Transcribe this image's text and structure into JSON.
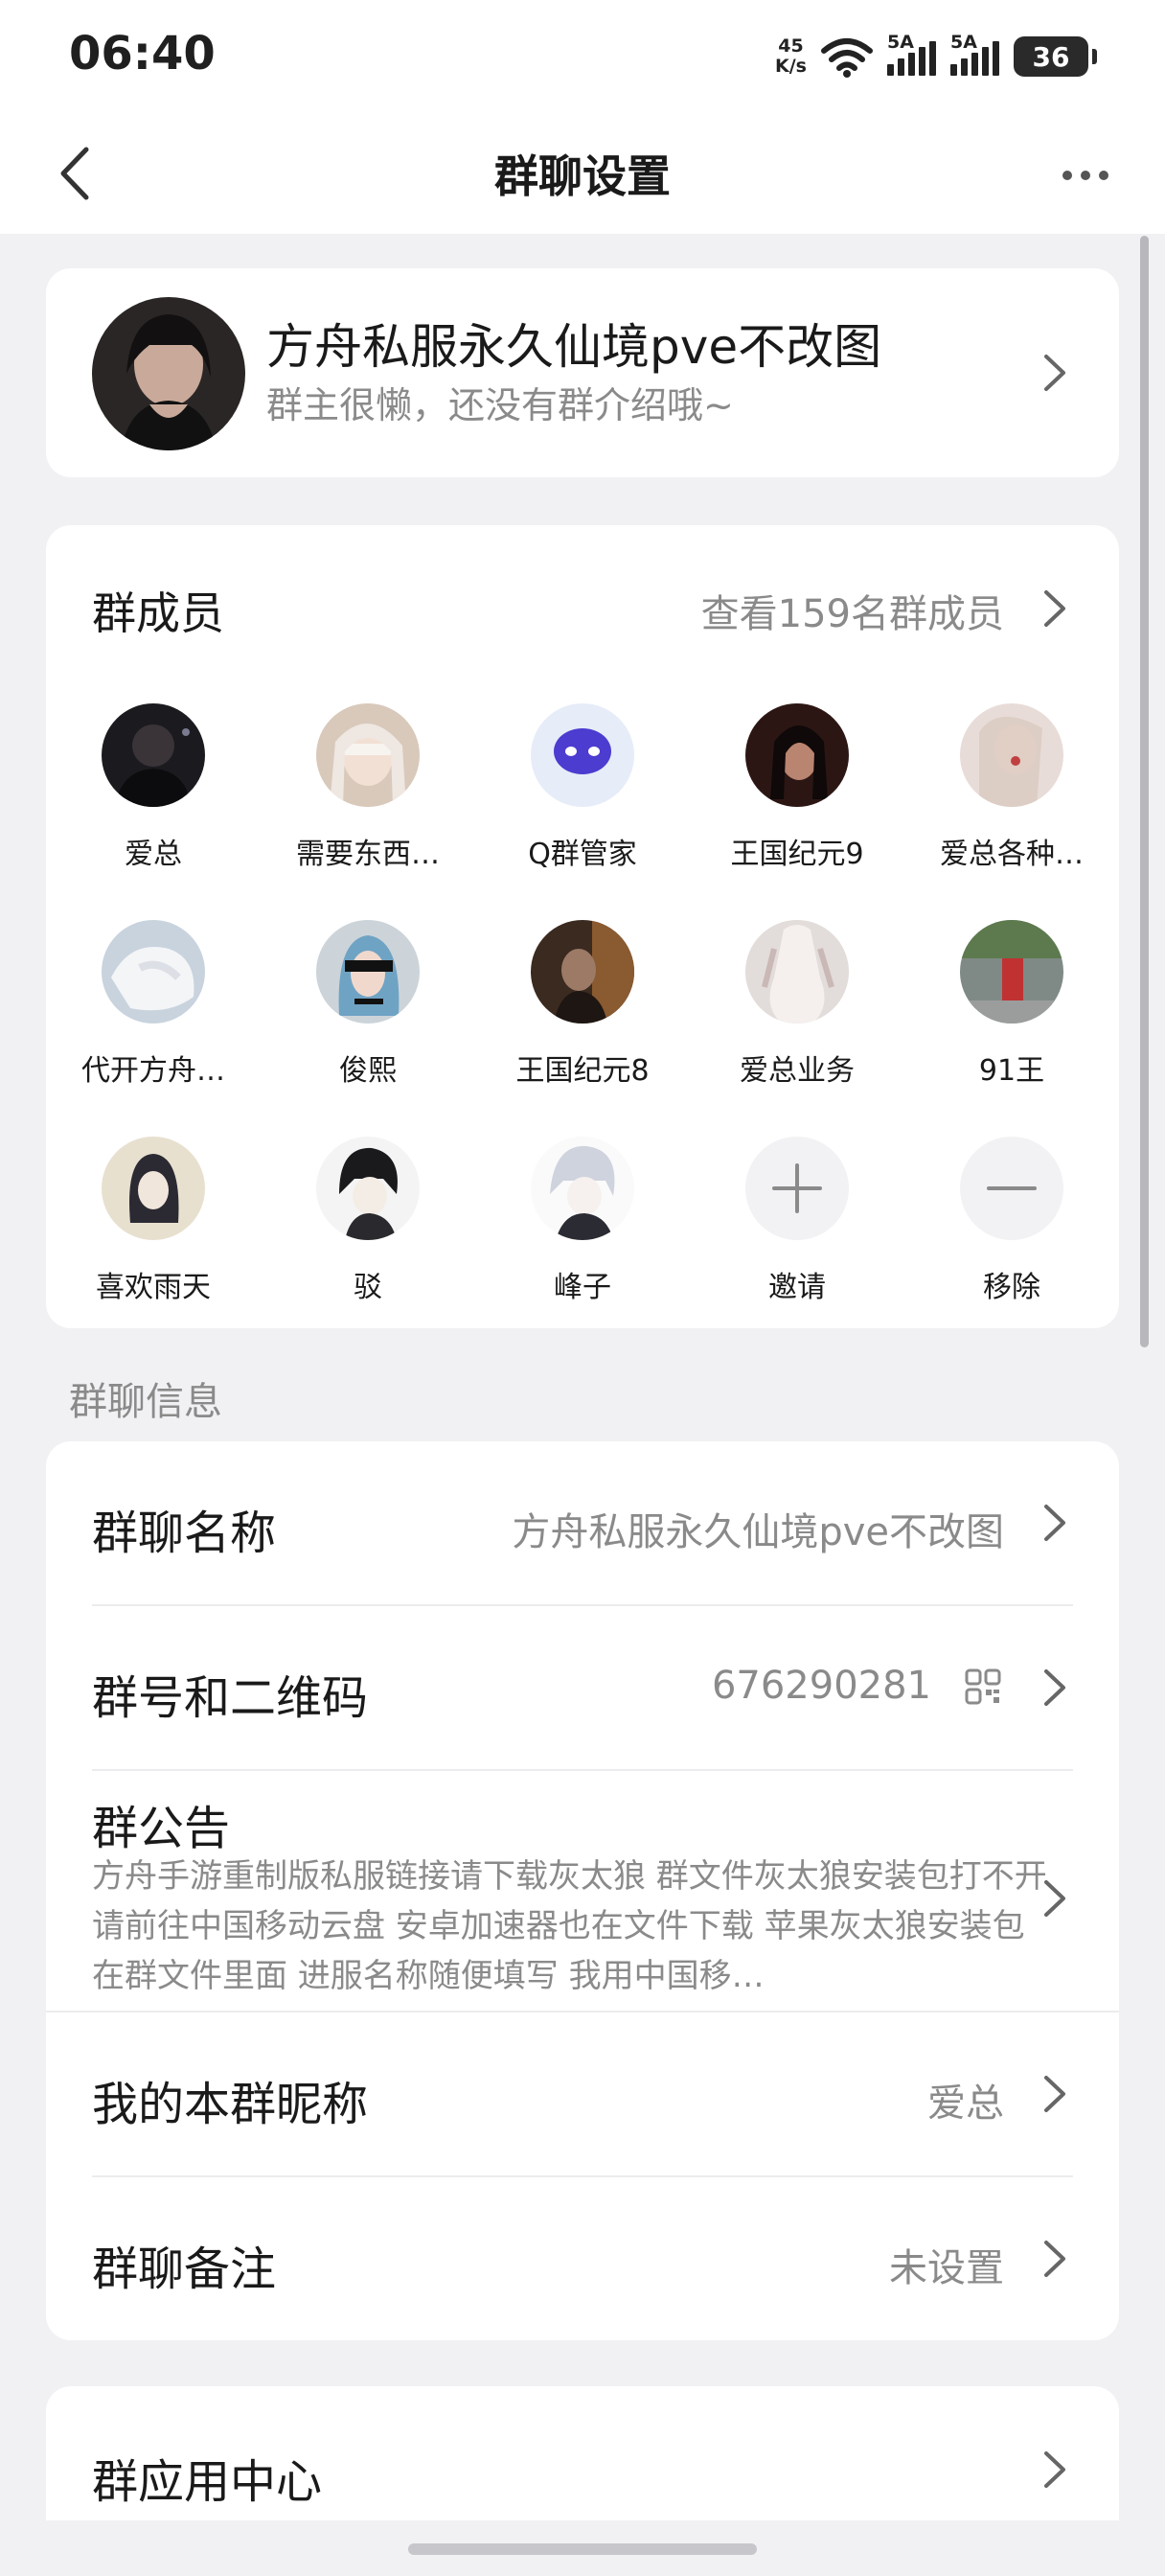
{
  "status_bar": {
    "time": "06:40",
    "speed_top": "45",
    "speed_unit": "K/s",
    "net_a": "5A",
    "net_b": "5A",
    "battery": "36"
  },
  "nav": {
    "title": "群聊设置"
  },
  "group": {
    "name": "方舟私服永久仙境pve不改图",
    "desc": "群主很懒，还没有群介绍哦~"
  },
  "members": {
    "title": "群成员",
    "view_all": "查看159名群成员",
    "list": [
      {
        "name": "爱总"
      },
      {
        "name": "需要东西…"
      },
      {
        "name": "Q群管家"
      },
      {
        "name": "王国纪元9"
      },
      {
        "name": "爱总各种…"
      },
      {
        "name": "代开方舟…"
      },
      {
        "name": "俊熙"
      },
      {
        "name": "王国纪元8"
      },
      {
        "name": "爱总业务"
      },
      {
        "name": "91王"
      },
      {
        "name": "喜欢雨天"
      },
      {
        "name": "驳"
      },
      {
        "name": "峰子"
      }
    ],
    "invite_label": "邀请",
    "remove_label": "移除"
  },
  "info": {
    "section_label": "群聊信息",
    "group_name_label": "群聊名称",
    "group_name_value": "方舟私服永久仙境pve不改图",
    "group_id_label": "群号和二维码",
    "group_id_value": "676290281",
    "notice_label": "群公告",
    "notice_text": "方舟手游重制版私服链接请下载灰太狼 群文件灰太狼安装包打不开 请前往中国移动云盘 安卓加速器也在文件下载 苹果灰太狼安装包在群文件里面 进服名称随便填写 我用中国移…",
    "nickname_label": "我的本群昵称",
    "nickname_value": "爱总",
    "remark_label": "群聊备注",
    "remark_value": "未设置"
  },
  "apps": {
    "label": "群应用中心"
  }
}
